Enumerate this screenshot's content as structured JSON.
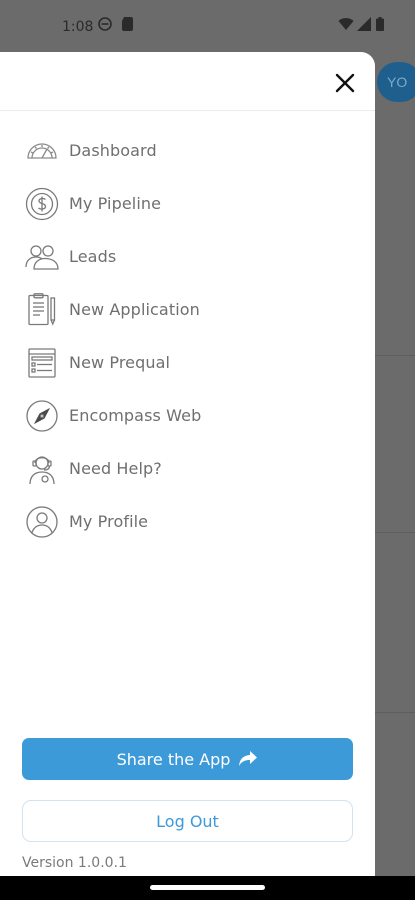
{
  "status_bar": {
    "time": "1:08",
    "icons": [
      "do-not-disturb-icon",
      "sim-card-icon",
      "wifi-icon",
      "signal-icon",
      "battery-icon"
    ]
  },
  "background": {
    "avatar_text": "YO"
  },
  "drawer": {
    "close_icon": "close-icon",
    "menu_items": [
      {
        "label": "Dashboard",
        "icon": "speedometer-icon"
      },
      {
        "label": "My Pipeline",
        "icon": "dollar-circle-icon"
      },
      {
        "label": "Leads",
        "icon": "users-icon"
      },
      {
        "label": "New Application",
        "icon": "clipboard-icon"
      },
      {
        "label": "New Prequal",
        "icon": "form-list-icon"
      },
      {
        "label": "Encompass Web",
        "icon": "compass-icon"
      },
      {
        "label": "Need Help?",
        "icon": "support-agent-icon"
      },
      {
        "label": "My Profile",
        "icon": "user-circle-icon"
      }
    ],
    "share_label": "Share the App",
    "share_icon": "share-arrow-icon",
    "logout_label": "Log Out",
    "version": "Version 1.0.0.1"
  },
  "colors": {
    "accent": "#3d9ad9",
    "overlay": "#6b6b6b",
    "menu_text": "#6f6f6f"
  }
}
